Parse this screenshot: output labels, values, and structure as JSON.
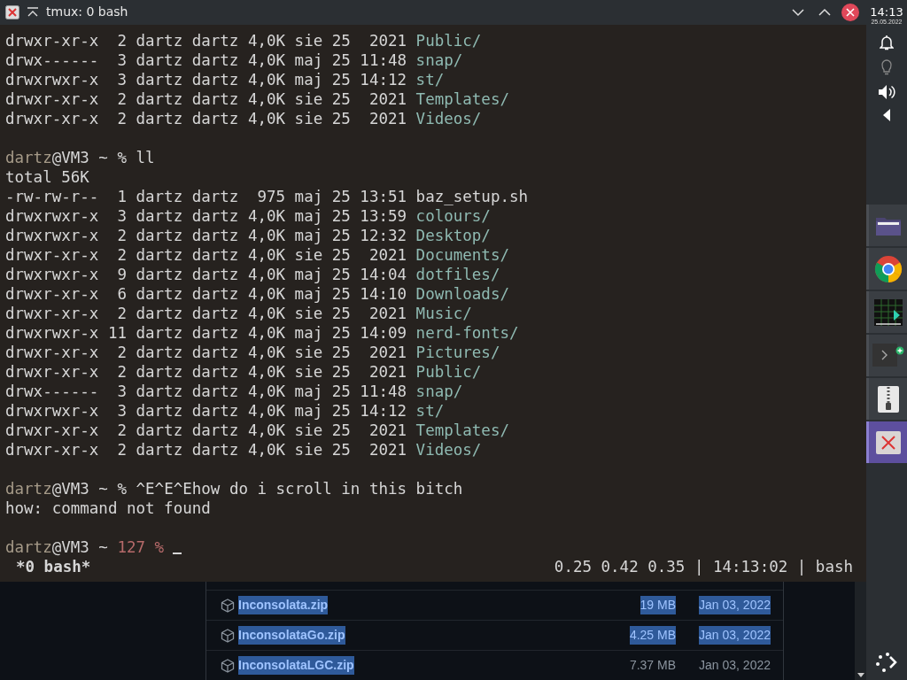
{
  "window": {
    "title": "tmux: 0 bash"
  },
  "terminal": {
    "lines": [
      {
        "kind": "entry",
        "text": "drwxr-xr-x  2 dartz dartz 4,0K sie 25  2021 ",
        "name": "Public/",
        "is_dir": true
      },
      {
        "kind": "entry",
        "text": "drwx------  3 dartz dartz 4,0K maj 25 11:48 ",
        "name": "snap/",
        "is_dir": true
      },
      {
        "kind": "entry",
        "text": "drwxrwxr-x  3 dartz dartz 4,0K maj 25 14:12 ",
        "name": "st/",
        "is_dir": true
      },
      {
        "kind": "entry",
        "text": "drwxr-xr-x  2 dartz dartz 4,0K sie 25  2021 ",
        "name": "Templates/",
        "is_dir": true
      },
      {
        "kind": "entry",
        "text": "drwxr-xr-x  2 dartz dartz 4,0K sie 25  2021 ",
        "name": "Videos/",
        "is_dir": true
      },
      {
        "kind": "blank"
      },
      {
        "kind": "prompt",
        "user": "dartz",
        "host": "@VM3 ~",
        "symbol": "%",
        "command": "ll",
        "cursor": false
      },
      {
        "kind": "output",
        "text": "total 56K"
      },
      {
        "kind": "entry",
        "text": "-rw-rw-r--  1 dartz dartz  975 maj 25 13:51 ",
        "name": "baz_setup.sh",
        "is_dir": false
      },
      {
        "kind": "entry",
        "text": "drwxrwxr-x  3 dartz dartz 4,0K maj 25 13:59 ",
        "name": "colours/",
        "is_dir": true
      },
      {
        "kind": "entry",
        "text": "drwxrwxr-x  2 dartz dartz 4,0K maj 25 12:32 ",
        "name": "Desktop/",
        "is_dir": true
      },
      {
        "kind": "entry",
        "text": "drwxr-xr-x  2 dartz dartz 4,0K sie 25  2021 ",
        "name": "Documents/",
        "is_dir": true
      },
      {
        "kind": "entry",
        "text": "drwxrwxr-x  9 dartz dartz 4,0K maj 25 14:04 ",
        "name": "dotfiles/",
        "is_dir": true
      },
      {
        "kind": "entry",
        "text": "drwxr-xr-x  6 dartz dartz 4,0K maj 25 14:10 ",
        "name": "Downloads/",
        "is_dir": true
      },
      {
        "kind": "entry",
        "text": "drwxr-xr-x  2 dartz dartz 4,0K sie 25  2021 ",
        "name": "Music/",
        "is_dir": true
      },
      {
        "kind": "entry",
        "text": "drwxrwxr-x 11 dartz dartz 4,0K maj 25 14:09 ",
        "name": "nerd-fonts/",
        "is_dir": true
      },
      {
        "kind": "entry",
        "text": "drwxr-xr-x  2 dartz dartz 4,0K sie 25  2021 ",
        "name": "Pictures/",
        "is_dir": true
      },
      {
        "kind": "entry",
        "text": "drwxr-xr-x  2 dartz dartz 4,0K sie 25  2021 ",
        "name": "Public/",
        "is_dir": true
      },
      {
        "kind": "entry",
        "text": "drwx------  3 dartz dartz 4,0K maj 25 11:48 ",
        "name": "snap/",
        "is_dir": true
      },
      {
        "kind": "entry",
        "text": "drwxrwxr-x  3 dartz dartz 4,0K maj 25 14:12 ",
        "name": "st/",
        "is_dir": true
      },
      {
        "kind": "entry",
        "text": "drwxr-xr-x  2 dartz dartz 4,0K sie 25  2021 ",
        "name": "Templates/",
        "is_dir": true
      },
      {
        "kind": "entry",
        "text": "drwxr-xr-x  2 dartz dartz 4,0K sie 25  2021 ",
        "name": "Videos/",
        "is_dir": true
      },
      {
        "kind": "blank"
      },
      {
        "kind": "prompt",
        "user": "dartz",
        "host": "@VM3 ~",
        "symbol": "%",
        "command": "^E^E^Ehow do i scroll in this bitch",
        "cursor": false
      },
      {
        "kind": "output",
        "text": "how: command not found"
      },
      {
        "kind": "blank"
      },
      {
        "kind": "prompt",
        "user": "dartz",
        "host": "@VM3 ~",
        "exit_code": "127",
        "symbol": "%",
        "cursor": true
      }
    ],
    "status_bar": {
      "session": "*0 bash*",
      "info": "0.25 0.42 0.35 | 14:13:02 | bash"
    }
  },
  "browser": {
    "files": [
      {
        "name": "Inconsolata.zip",
        "size": "19 MB",
        "date": "Jan 03, 2022",
        "name_highlighted": true,
        "details_highlighted": true
      },
      {
        "name": "InconsolataGo.zip",
        "size": "4.25 MB",
        "date": "Jan 03, 2022",
        "name_highlighted": true,
        "details_highlighted": true
      },
      {
        "name": "InconsolataLGC.zip",
        "size": "7.37 MB",
        "date": "Jan 03, 2022",
        "name_highlighted": true,
        "details_highlighted": false
      }
    ]
  },
  "panel": {
    "clock": {
      "time": "14:13",
      "date": "25.05.2022"
    },
    "tasks": [
      {
        "kind": "folder",
        "selected": false
      },
      {
        "kind": "browser",
        "selected": false
      },
      {
        "kind": "monitor",
        "selected": false
      },
      {
        "kind": "terminal",
        "selected": false
      },
      {
        "kind": "archive",
        "selected": false
      },
      {
        "kind": "close",
        "selected": true
      }
    ]
  }
}
